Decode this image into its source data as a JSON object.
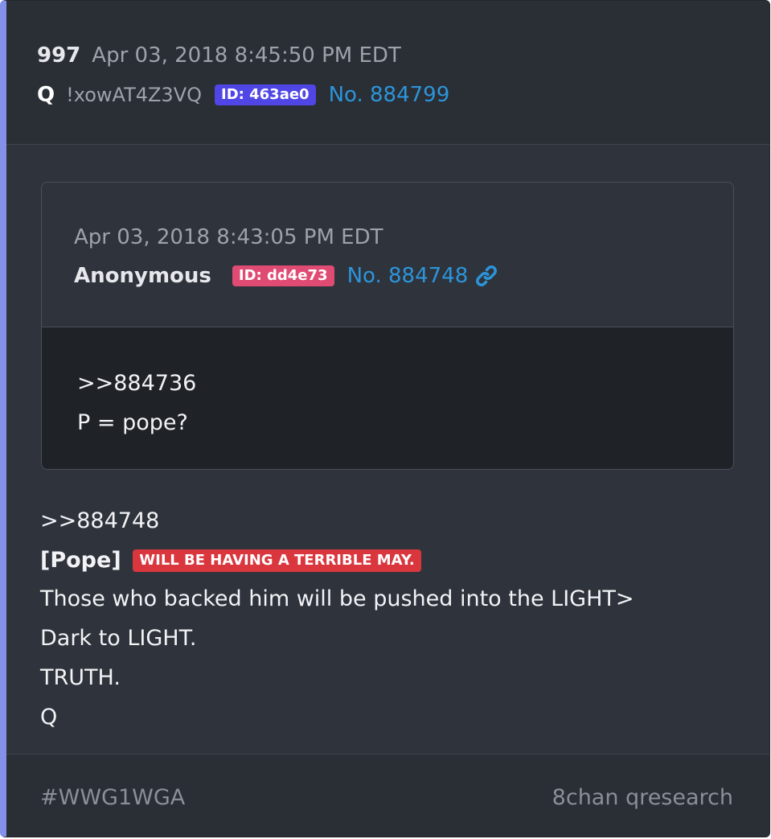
{
  "post": {
    "number": "997",
    "date": "Apr 03, 2018 8:45:50 PM EDT",
    "author": "Q",
    "tripcode": "!xowAT4Z3VQ",
    "id_badge": "ID: 463ae0",
    "post_no": "No. 884799"
  },
  "quoted_post": {
    "date": "Apr 03, 2018 8:43:05 PM EDT",
    "author": "Anonymous",
    "id_badge": "ID: dd4e73",
    "post_no": "No. 884748",
    "link_icon": "link-icon",
    "body": [
      ">>884736",
      "P = pope?"
    ]
  },
  "body": {
    "reply_ref": ">>884748",
    "pope_tag": "[Pope]",
    "highlight": "WILL BE HAVING A TERRIBLE MAY.",
    "lines": [
      "Those who backed him will be pushed into the LIGHT>",
      "Dark to LIGHT.",
      "TRUTH.",
      "Q"
    ]
  },
  "footer": {
    "hashtag": "#WWG1WGA",
    "source": "8chan qresearch"
  },
  "colors": {
    "card_bg": "#2f333c",
    "accent_border": "#8391e9",
    "link": "#2c95da",
    "id_blue": "#4f46e5",
    "id_pink": "#e04b73",
    "highlight_red": "#d9363e"
  }
}
